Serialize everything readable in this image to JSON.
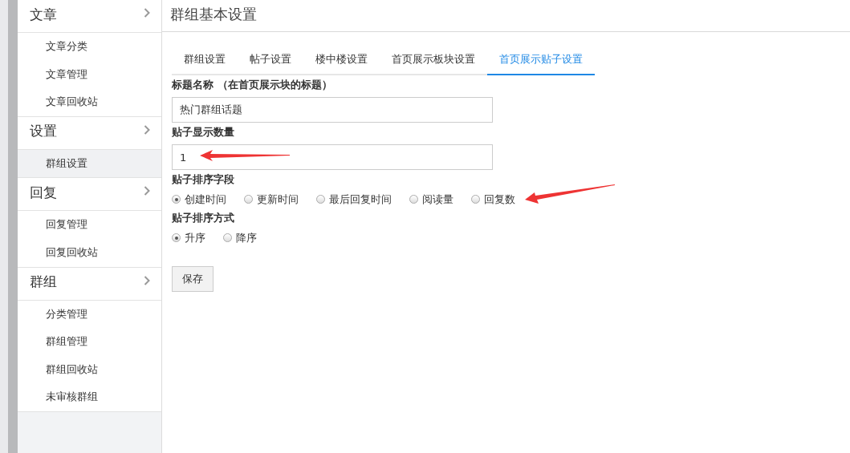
{
  "sidebar": {
    "groups": [
      {
        "title": "文章",
        "items": [
          {
            "label": "文章分类",
            "selected": false
          },
          {
            "label": "文章管理",
            "selected": false
          },
          {
            "label": "文章回收站",
            "selected": false
          }
        ]
      },
      {
        "title": "设置",
        "items": [
          {
            "label": "群组设置",
            "selected": true
          }
        ]
      },
      {
        "title": "回复",
        "items": [
          {
            "label": "回复管理",
            "selected": false
          },
          {
            "label": "回复回收站",
            "selected": false
          }
        ]
      },
      {
        "title": "群组",
        "items": [
          {
            "label": "分类管理",
            "selected": false
          },
          {
            "label": "群组管理",
            "selected": false
          },
          {
            "label": "群组回收站",
            "selected": false
          },
          {
            "label": "未审核群组",
            "selected": false
          }
        ]
      }
    ]
  },
  "page_title": "群组基本设置",
  "tabs": [
    {
      "label": "群组设置",
      "selected": false
    },
    {
      "label": "帖子设置",
      "selected": false
    },
    {
      "label": "楼中楼设置",
      "selected": false
    },
    {
      "label": "首页展示板块设置",
      "selected": false
    },
    {
      "label": "首页展示贴子设置",
      "selected": true
    }
  ],
  "form": [
    {
      "kind": "text",
      "label": "标题名称 （在首页展示块的标题）",
      "value": "热门群组话题"
    },
    {
      "kind": "text",
      "label": "贴子显示数量",
      "value": "1"
    },
    {
      "kind": "radio",
      "label": "贴子排序字段",
      "options": [
        {
          "label": "创建时间",
          "selected": true
        },
        {
          "label": "更新时间",
          "selected": false
        },
        {
          "label": "最后回复时间",
          "selected": false
        },
        {
          "label": "阅读量",
          "selected": false
        },
        {
          "label": "回复数",
          "selected": false
        }
      ]
    },
    {
      "kind": "radio",
      "label": "贴子排序方式",
      "options": [
        {
          "label": "升序",
          "selected": true
        },
        {
          "label": "降序",
          "selected": false
        }
      ]
    }
  ],
  "save_button": "保存"
}
